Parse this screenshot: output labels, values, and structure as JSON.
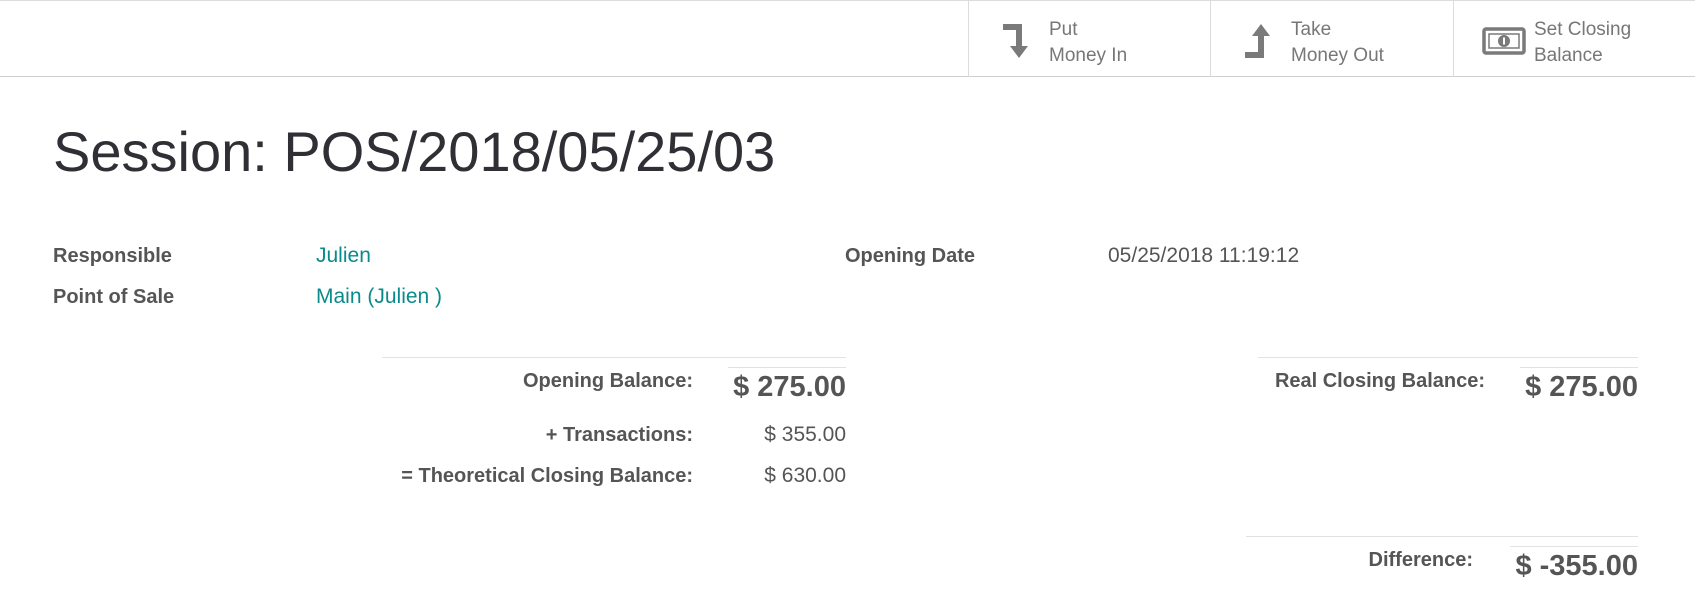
{
  "toolbar": {
    "put_in": {
      "line1": "Put",
      "line2": "Money In"
    },
    "take_out": {
      "line1": "Take",
      "line2": "Money Out"
    },
    "set_closing": {
      "line1": "Set Closing",
      "line2": "Balance"
    }
  },
  "session": {
    "title": "Session: POS/2018/05/25/03",
    "responsible_label": "Responsible",
    "responsible_value": "Julien",
    "pos_label": "Point of Sale",
    "pos_value": "Main (Julien )",
    "opening_date_label": "Opening Date",
    "opening_date_value": "05/25/2018 11:19:12"
  },
  "balances": {
    "opening_label": "Opening Balance:",
    "opening_value": "$ 275.00",
    "transactions_label": "+ Transactions:",
    "transactions_value": "$ 355.00",
    "theoretical_label": "= Theoretical Closing Balance:",
    "theoretical_value": "$ 630.00",
    "real_closing_label": "Real Closing Balance:",
    "real_closing_value": "$ 275.00",
    "difference_label": "Difference:",
    "difference_value": "$ -355.00"
  },
  "colors": {
    "link": "#0a8b8b",
    "icon": "#7a7a7a"
  }
}
